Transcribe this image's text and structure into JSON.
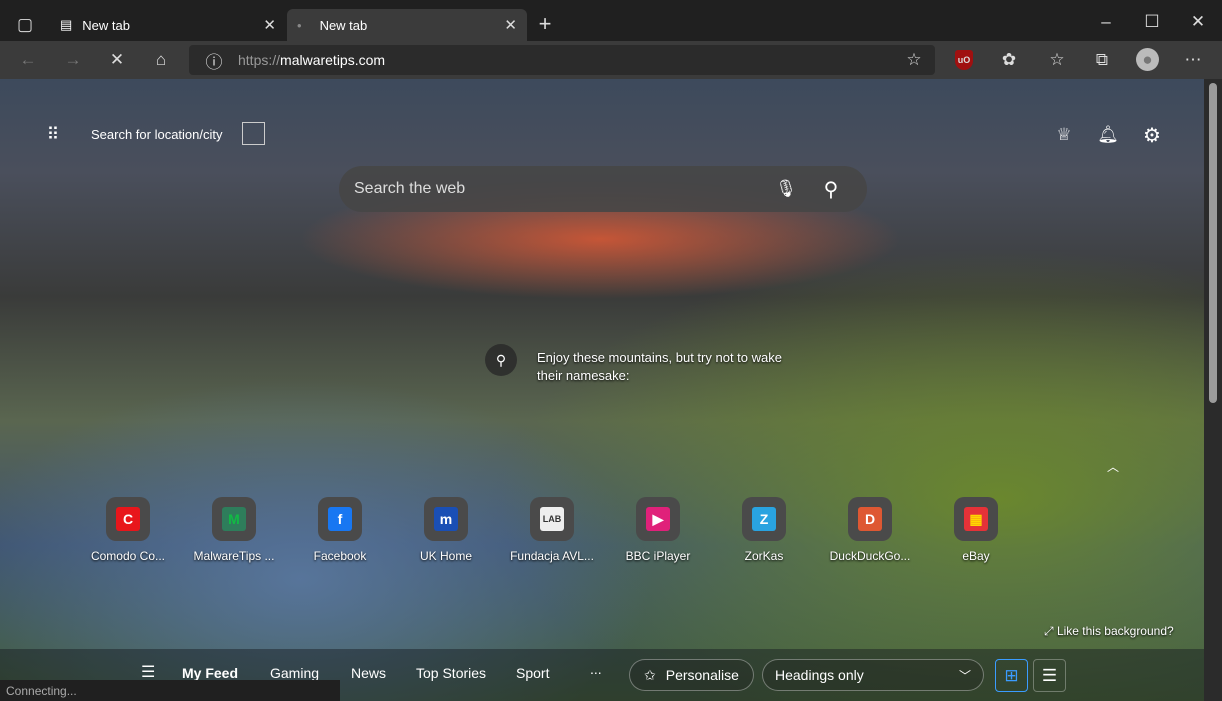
{
  "tabs": [
    {
      "title": "New tab"
    },
    {
      "title": "New tab"
    }
  ],
  "address": {
    "scheme": "https://",
    "host": "malwaretips.com"
  },
  "page": {
    "location_label": "Search for location/city",
    "search_placeholder": "Search the web",
    "caption": "Enjoy these mountains, but try not to wake their namesake:",
    "like_background": "Like this background?",
    "tiles": [
      {
        "label": "Comodo Co...",
        "bg": "#e8161b",
        "glyph": "C",
        "fg": "#fff"
      },
      {
        "label": "MalwareTips ...",
        "bg": "#2e7d5b",
        "glyph": "M",
        "fg": "#1b4"
      },
      {
        "label": "Facebook",
        "bg": "#1877f2",
        "glyph": "f",
        "fg": "#fff"
      },
      {
        "label": "UK Home",
        "bg": "#1a4fb5",
        "glyph": "m",
        "fg": "#fff"
      },
      {
        "label": "Fundacja AVL...",
        "bg": "#eee",
        "glyph": "LAB",
        "fg": "#333"
      },
      {
        "label": "BBC iPlayer",
        "bg": "#e0217a",
        "glyph": "▶",
        "fg": "#fff"
      },
      {
        "label": "ZorKas",
        "bg": "#29a3e0",
        "glyph": "Z",
        "fg": "#fff"
      },
      {
        "label": "DuckDuckGo...",
        "bg": "#de5833",
        "glyph": "D",
        "fg": "#fff"
      },
      {
        "label": "eBay",
        "bg": "#e53238",
        "glyph": "▦",
        "fg": "#ffd700"
      }
    ],
    "feed": {
      "items": [
        "My Feed",
        "Gaming",
        "News",
        "Top Stories",
        "Sport"
      ],
      "more": "...",
      "personalise": "Personalise",
      "layout_select": "Headings only"
    }
  },
  "status": "Connecting..."
}
